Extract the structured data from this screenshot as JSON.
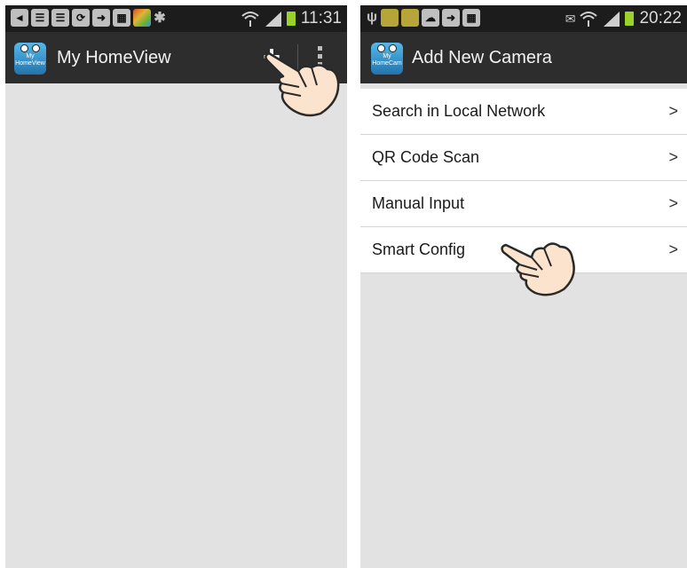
{
  "left_screen": {
    "status": {
      "clock": "11:31"
    },
    "app": {
      "icon_text_1": "My",
      "icon_text_2": "HomeView",
      "title": "My HomeView",
      "add_label": "+"
    }
  },
  "right_screen": {
    "status": {
      "clock": "20:22"
    },
    "app": {
      "icon_text_1": "My",
      "icon_text_2": "HomeCam",
      "title": "Add New Camera"
    },
    "menu": [
      {
        "label": "Search in Local Network",
        "chevron": ">"
      },
      {
        "label": "QR Code Scan",
        "chevron": ">"
      },
      {
        "label": "Manual Input",
        "chevron": ">"
      },
      {
        "label": "Smart Config",
        "chevron": ">"
      }
    ]
  },
  "colors": {
    "action_bar": "#2d2d2d",
    "status_bar": "#1c1c1c",
    "content_bg": "#e2e2e2",
    "battery": "#9ad12a"
  },
  "icons": [
    "back-icon",
    "gallery-icon",
    "sync-icon",
    "bluetooth-icon",
    "wifi-icon",
    "signal-icon",
    "battery-icon",
    "usb-icon",
    "pointing-hand-icon"
  ]
}
